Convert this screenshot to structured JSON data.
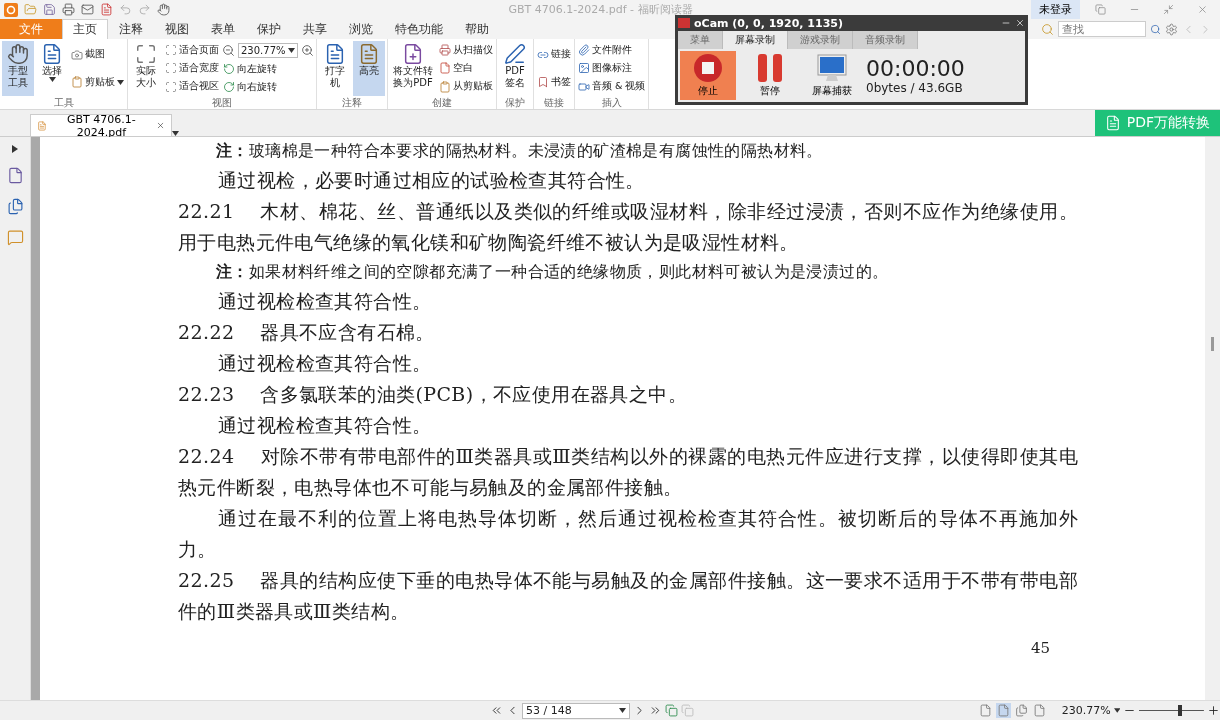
{
  "window": {
    "title": "GBT 4706.1-2024.pdf - 福昕阅读器",
    "login": "未登录"
  },
  "menu_tabs": [
    {
      "label": "文件",
      "kind": "file",
      "selected": false
    },
    {
      "label": "主页",
      "kind": "tab",
      "selected": true
    },
    {
      "label": "注释",
      "kind": "tab",
      "selected": false
    },
    {
      "label": "视图",
      "kind": "tab",
      "selected": false
    },
    {
      "label": "表单",
      "kind": "tab",
      "selected": false
    },
    {
      "label": "保护",
      "kind": "tab",
      "selected": false
    },
    {
      "label": "共享",
      "kind": "tab",
      "selected": false
    },
    {
      "label": "浏览",
      "kind": "tab",
      "selected": false
    },
    {
      "label": "特色功能",
      "kind": "tab",
      "selected": false
    },
    {
      "label": "帮助",
      "kind": "tab",
      "selected": false
    }
  ],
  "search": {
    "placeholder": "查找"
  },
  "ribbon": {
    "groups": [
      {
        "label": "工具",
        "items": [
          {
            "kind": "large",
            "label": "手型工具",
            "selected": true,
            "dropdown": false
          },
          {
            "kind": "large",
            "label": "选择",
            "selected": false,
            "dropdown": true
          },
          {
            "kind": "small",
            "label": "截图",
            "dropdown": false
          },
          {
            "kind": "small",
            "label": "剪贴板",
            "dropdown": true
          }
        ]
      },
      {
        "label": "视图",
        "items": [
          {
            "kind": "large",
            "label": "实际大小",
            "selected": false,
            "dropdown": false
          },
          {
            "kind": "small",
            "label": "适合页面",
            "dropdown": false
          },
          {
            "kind": "small",
            "label": "适合宽度",
            "dropdown": false
          },
          {
            "kind": "small",
            "label": "适合视区",
            "dropdown": false
          },
          {
            "kind": "zoom",
            "value": "230.77%"
          },
          {
            "kind": "small",
            "label": "向左旋转",
            "dropdown": false
          },
          {
            "kind": "small",
            "label": "向右旋转",
            "dropdown": false
          }
        ]
      },
      {
        "label": "注释",
        "items": [
          {
            "kind": "large",
            "label": "打字机",
            "selected": false,
            "dropdown": false
          },
          {
            "kind": "large",
            "label": "高亮",
            "selected": true,
            "dropdown": false
          }
        ]
      },
      {
        "label": "创建",
        "items": [
          {
            "kind": "large",
            "label": "将文件转换为PDF",
            "selected": false,
            "dropdown": false
          },
          {
            "kind": "small",
            "label": "从扫描仪",
            "dropdown": false
          },
          {
            "kind": "small",
            "label": "空白",
            "dropdown": false
          },
          {
            "kind": "small",
            "label": "从剪贴板",
            "dropdown": false
          }
        ]
      },
      {
        "label": "保护",
        "items": [
          {
            "kind": "large",
            "label": "PDF签名",
            "selected": false,
            "dropdown": false
          }
        ]
      },
      {
        "label": "链接",
        "items": [
          {
            "kind": "small",
            "label": "链接",
            "dropdown": false
          },
          {
            "kind": "small",
            "label": "书签",
            "dropdown": false
          }
        ]
      },
      {
        "label": "插入",
        "items": [
          {
            "kind": "small",
            "label": "文件附件",
            "dropdown": false
          },
          {
            "kind": "small",
            "label": "图像标注",
            "dropdown": false
          },
          {
            "kind": "small",
            "label": "音频 & 视频",
            "dropdown": false
          }
        ]
      }
    ]
  },
  "document_tab": {
    "title": "GBT 4706.1-2024.pdf"
  },
  "convert_button": "PDF万能转换",
  "page": {
    "paragraphs": [
      {
        "kind": "note",
        "text": "**注：**玻璃棉是一种符合本要求的隔热材料。未浸渍的矿渣棉是有腐蚀性的隔热材料。"
      },
      {
        "kind": "indent",
        "text": "通过视检，必要时通过相应的试验检查其符合性。"
      },
      {
        "kind": "numbered",
        "number": "22.21",
        "text": "木材、棉花、丝、普通纸以及类似的纤维或吸湿材料，除非经过浸渍，否则不应作为绝缘使用。用于电热元件电气绝缘的氧化镁和矿物陶瓷纤维不被认为是吸湿性材料。"
      },
      {
        "kind": "note",
        "text": "**注：**如果材料纤维之间的空隙都充满了一种合适的绝缘物质，则此材料可被认为是浸渍过的。"
      },
      {
        "kind": "indent",
        "text": "通过视检检查其符合性。"
      },
      {
        "kind": "numbered",
        "number": "22.22",
        "text": "器具不应含有石棉。"
      },
      {
        "kind": "indent",
        "text": "通过视检检查其符合性。"
      },
      {
        "kind": "numbered",
        "number": "22.23",
        "text": "含多氯联苯的油类(PCB)，不应使用在器具之中。"
      },
      {
        "kind": "indent",
        "text": "通过视检检查其符合性。"
      },
      {
        "kind": "numbered",
        "number": "22.24",
        "text": "对除不带有带电部件的Ⅲ类器具或Ⅲ类结构以外的裸露的电热元件应进行支撑，以使得即使其电热元件断裂，电热导体也不可能与易触及的金属部件接触。"
      },
      {
        "kind": "indent",
        "text": "通过在最不利的位置上将电热导体切断，然后通过视检检查其符合性。被切断后的导体不再施加外力。"
      },
      {
        "kind": "numbered",
        "number": "22.25",
        "text": "器具的结构应使下垂的电热导体不能与易触及的金属部件接触。这一要求不适用于不带有带电部件的Ⅲ类器具或Ⅲ类结构。"
      }
    ],
    "page_number": "45"
  },
  "status_bar": {
    "page_field": "53 / 148",
    "views": [
      {
        "selected": false
      },
      {
        "selected": true
      },
      {
        "selected": false
      },
      {
        "selected": false
      }
    ],
    "zoom": "230.77%",
    "zoom_slider": {
      "level": 0.63
    }
  },
  "ocam": {
    "title": "oCam (0, 0, 1920, 1135)",
    "tabs": [
      {
        "label": "菜单",
        "selected": false
      },
      {
        "label": "屏幕录制",
        "selected": true
      },
      {
        "label": "游戏录制",
        "selected": false
      },
      {
        "label": "音频录制",
        "selected": false
      }
    ],
    "buttons": [
      {
        "label": "停止",
        "kind": "stop",
        "selected": true
      },
      {
        "label": "暂停",
        "kind": "pause",
        "selected": false
      },
      {
        "label": "屏幕捕获",
        "kind": "capture",
        "selected": false
      }
    ],
    "timer": "00:00:00",
    "storage": "0bytes / 43.6GB"
  }
}
